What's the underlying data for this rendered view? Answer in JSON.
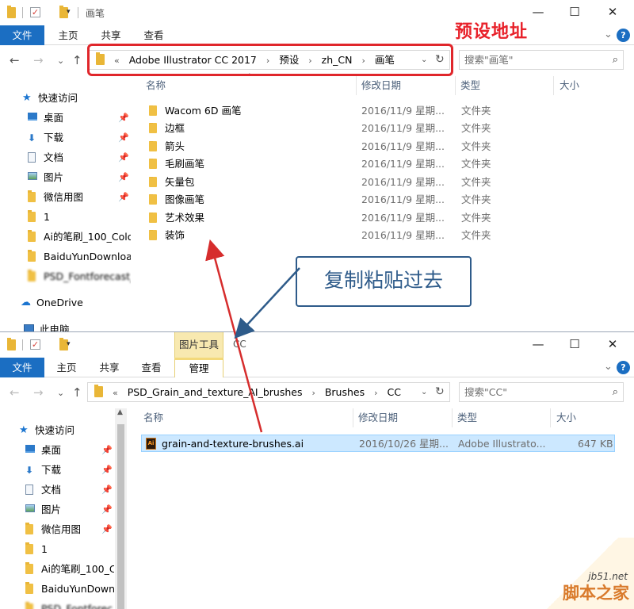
{
  "window1": {
    "title": "画笔",
    "tabs": [
      "文件",
      "主页",
      "共享",
      "查看"
    ],
    "breadcrumb": [
      "«",
      "Adobe Illustrator CC 2017",
      "预设",
      "zh_CN",
      "画笔"
    ],
    "search_placeholder": "搜索\"画笔\"",
    "columns": [
      "名称",
      "修改日期",
      "类型",
      "大小"
    ],
    "sidebar": [
      {
        "label": "快速访问",
        "icon": "star-icon"
      },
      {
        "label": "桌面",
        "icon": "desktop-icon",
        "pinned": true
      },
      {
        "label": "下载",
        "icon": "download-icon",
        "pinned": true
      },
      {
        "label": "文档",
        "icon": "document-icon",
        "pinned": true
      },
      {
        "label": "图片",
        "icon": "picture-icon",
        "pinned": true
      },
      {
        "label": "微信用图",
        "icon": "folder-icon",
        "pinned": true
      },
      {
        "label": "1",
        "icon": "folder-icon"
      },
      {
        "label": "Ai的笔刷_100_Colo",
        "icon": "folder-icon"
      },
      {
        "label": "BaiduYunDownloa",
        "icon": "folder-icon"
      },
      {
        "label": "PSD_Fontforecast_",
        "icon": "folder-icon"
      },
      {
        "label": "OneDrive",
        "icon": "onedrive-icon"
      },
      {
        "label": "此电脑",
        "icon": "pc-icon"
      }
    ],
    "files": [
      {
        "name": "Wacom 6D 画笔",
        "date": "2016/11/9 星期...",
        "type": "文件夹"
      },
      {
        "name": "边框",
        "date": "2016/11/9 星期...",
        "type": "文件夹"
      },
      {
        "name": "箭头",
        "date": "2016/11/9 星期...",
        "type": "文件夹"
      },
      {
        "name": "毛刷画笔",
        "date": "2016/11/9 星期...",
        "type": "文件夹"
      },
      {
        "name": "矢量包",
        "date": "2016/11/9 星期...",
        "type": "文件夹"
      },
      {
        "name": "图像画笔",
        "date": "2016/11/9 星期...",
        "type": "文件夹"
      },
      {
        "name": "艺术效果",
        "date": "2016/11/9 星期...",
        "type": "文件夹"
      },
      {
        "name": "装饰",
        "date": "2016/11/9 星期...",
        "type": "文件夹"
      }
    ]
  },
  "window2": {
    "title": "CC",
    "context_tab": "图片工具",
    "context_subtab": "管理",
    "tabs": [
      "文件",
      "主页",
      "共享",
      "查看"
    ],
    "breadcrumb": [
      "«",
      "PSD_Grain_and_texture_AI_brushes",
      "Brushes",
      "CC"
    ],
    "search_placeholder": "搜索\"CC\"",
    "columns": [
      "名称",
      "修改日期",
      "类型",
      "大小"
    ],
    "sidebar": [
      {
        "label": "快速访问",
        "icon": "star-icon"
      },
      {
        "label": "桌面",
        "icon": "desktop-icon",
        "pinned": true
      },
      {
        "label": "下载",
        "icon": "download-icon",
        "pinned": true
      },
      {
        "label": "文档",
        "icon": "document-icon",
        "pinned": true
      },
      {
        "label": "图片",
        "icon": "picture-icon",
        "pinned": true
      },
      {
        "label": "微信用图",
        "icon": "folder-icon",
        "pinned": true
      },
      {
        "label": "1",
        "icon": "folder-icon"
      },
      {
        "label": "Ai的笔刷_100_C",
        "icon": "folder-icon"
      },
      {
        "label": "BaiduYunDown",
        "icon": "folder-icon"
      },
      {
        "label": "PSD_Fontforec",
        "icon": "folder-icon"
      }
    ],
    "files": [
      {
        "name": "grain-and-texture-brushes.ai",
        "date": "2016/10/26 星期...",
        "type": "Adobe Illustrato...",
        "size": "647 KB"
      }
    ]
  },
  "annotations": {
    "address_label": "预设地址",
    "callout": "复制粘贴过去"
  },
  "watermark": {
    "site": "jb51.net",
    "name": "脚本之家"
  },
  "colors": {
    "accent": "#1b6ec2",
    "annotation_red": "#e0262b",
    "callout_blue": "#2e5b8a",
    "selection": "#cce8ff",
    "folder": "#e9b637"
  }
}
